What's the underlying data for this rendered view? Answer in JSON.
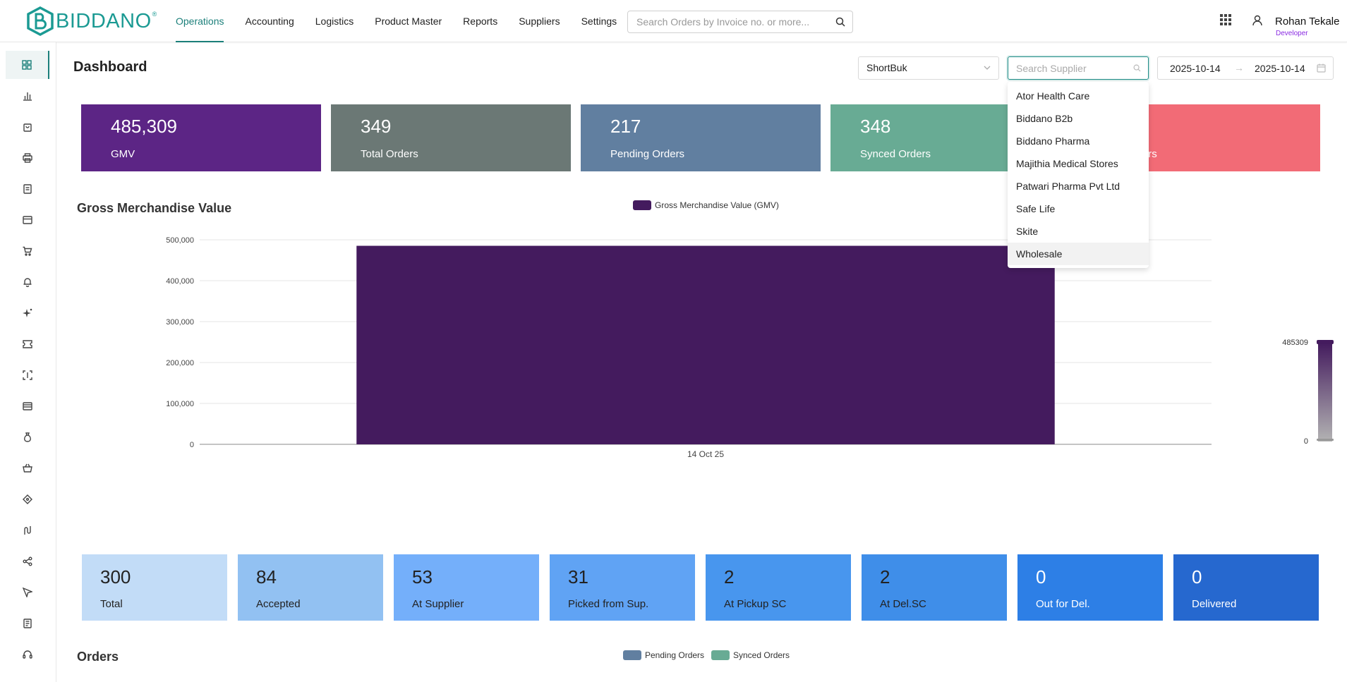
{
  "brand": {
    "name": "BIDDANO",
    "reg": "®",
    "color": "#1b9a93"
  },
  "nav": [
    {
      "label": "Operations",
      "active": true
    },
    {
      "label": "Accounting"
    },
    {
      "label": "Logistics"
    },
    {
      "label": "Product Master"
    },
    {
      "label": "Reports"
    },
    {
      "label": "Suppliers"
    },
    {
      "label": "Settings"
    }
  ],
  "search": {
    "placeholder": "Search Orders by Invoice no. or more...",
    "value": ""
  },
  "user": {
    "name": "Rohan Tekale",
    "role": "Developer"
  },
  "sidebar": {
    "icons": [
      "dashboard-icon",
      "bar-chart-icon",
      "shopping-bag-icon",
      "printer-icon",
      "document-icon",
      "card-icon",
      "cart-icon",
      "bell-icon",
      "sparkle-icon",
      "ticket-icon",
      "scan-icon",
      "wallet-icon",
      "money-bag-icon",
      "basket-icon",
      "tag-icon",
      "route-icon",
      "share-icon",
      "send-icon",
      "report-icon",
      "headset-icon"
    ]
  },
  "page": {
    "title": "Dashboard"
  },
  "filters": {
    "company_select": "ShortBuk",
    "supplier_search_placeholder": "Search Supplier",
    "supplier_search_value": "",
    "date_start": "2025-10-14",
    "date_arrow": "→",
    "date_end": "2025-10-14"
  },
  "dropdown": {
    "items": [
      "Ator Health Care",
      "Biddano B2b",
      "Biddano Pharma",
      "Majithia Medical Stores",
      "Patwari Pharma Pvt Ltd",
      "Safe Life",
      "Skite",
      "Wholesale"
    ],
    "hovered": "Wholesale"
  },
  "kpis": [
    {
      "value": "485,309",
      "label": "GMV",
      "color": "#5c2585"
    },
    {
      "value": "349",
      "label": "Total Orders",
      "color": "#6b7875"
    },
    {
      "value": "217",
      "label": "Pending Orders",
      "color": "#617fa0"
    },
    {
      "value": "348",
      "label": "Synced Orders",
      "color": "#68ab94"
    },
    {
      "value": "",
      "label": "ed Orders",
      "color": "#f26b76"
    }
  ],
  "gmv_chart": {
    "title": "Gross Merchandise Value",
    "legend": "Gross Merchandise Value (GMV)",
    "bar_color": "#441b5e"
  },
  "chart_data": {
    "type": "bar",
    "title": "Gross Merchandise Value",
    "categories": [
      "14 Oct 25"
    ],
    "series": [
      {
        "name": "Gross Merchandise Value (GMV)",
        "values": [
          485309
        ]
      }
    ],
    "ylim": [
      0,
      500000
    ],
    "yticks": [
      "0",
      "100,000",
      "200,000",
      "300,000",
      "400,000",
      "500,000"
    ],
    "grid": true,
    "legend": "top-center",
    "visual_map": {
      "max_label": "485309",
      "min_label": "0"
    }
  },
  "delivery": [
    {
      "value": "300",
      "label": "Total",
      "color": "#c2dcf7",
      "text": "#222"
    },
    {
      "value": "84",
      "label": "Accepted",
      "color": "#92c1f2",
      "text": "#222"
    },
    {
      "value": "53",
      "label": "At Supplier",
      "color": "#74affa",
      "text": "#222"
    },
    {
      "value": "31",
      "label": "Picked from Sup.",
      "color": "#60a3f4",
      "text": "#222"
    },
    {
      "value": "2",
      "label": "At Pickup SC",
      "color": "#4896ee",
      "text": "#222"
    },
    {
      "value": "2",
      "label": "At Del.SC",
      "color": "#3f8ee9",
      "text": "#222"
    },
    {
      "value": "0",
      "label": "Out for Del.",
      "color": "#2d7fe6",
      "text": "#fff"
    },
    {
      "value": "0",
      "label": "Delivered",
      "color": "#2668cf",
      "text": "#fff"
    }
  ],
  "orders": {
    "title": "Orders",
    "legend": [
      {
        "name": "Pending Orders",
        "color": "#617fa0"
      },
      {
        "name": "Synced Orders",
        "color": "#68ab94"
      }
    ]
  }
}
